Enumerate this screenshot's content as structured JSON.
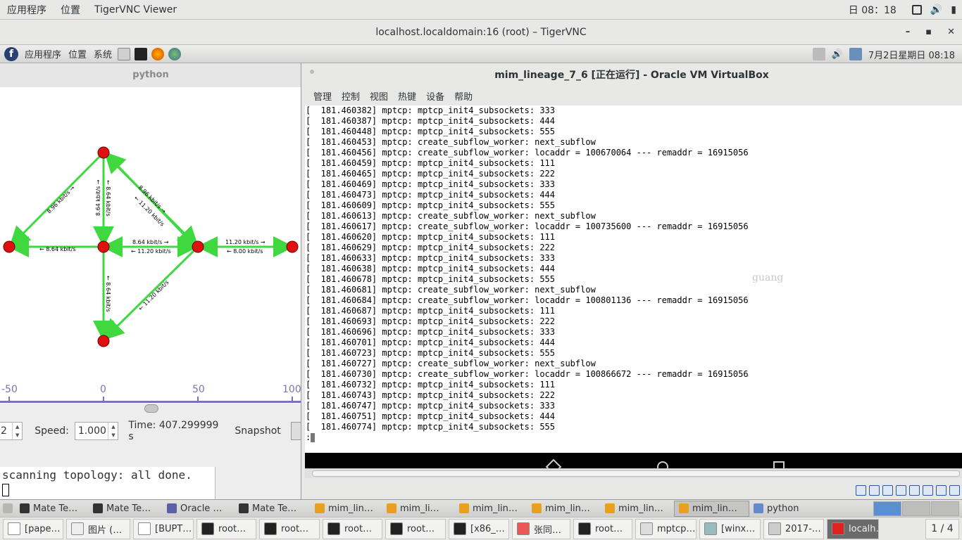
{
  "host_bar": {
    "apps": "应用程序",
    "places": "位置",
    "active_app": "TigerVNC Viewer",
    "clock": "日 08：18"
  },
  "vnc_window": {
    "title": "localhost.localdomain:16 (root) – TigerVNC",
    "minimize": "–",
    "maximize": "▪",
    "close": "✕"
  },
  "mate_panel": {
    "apps": "应用程序",
    "places": "位置",
    "system": "系统",
    "datetime": "7月2日星期日 08:18"
  },
  "python_window": {
    "title": "python",
    "link_labels": [
      "← 8.64 kbit/s",
      "8.96 kbit/s →",
      "8.96 kbit/s →",
      "← 11.20 kbit/s",
      "8.64 kbit/s →",
      "← 11.20 kbit/s",
      "11.20 kbit/s →",
      "← 8.00 kbit/s",
      "8.64 kbit/s →",
      "← 8.64 kbit/s",
      "← 8.64 kbit/s",
      "← 11.20 kbit/s",
      "8.64 kbit/s"
    ],
    "ruler_ticks": [
      "-50",
      "0",
      "50",
      "100"
    ],
    "spin_value": "2",
    "speed_label": "Speed:",
    "speed_value": "1.000",
    "time_text": "Time: 407.299999 s",
    "snapshot_label": "Snapshot",
    "console_text": "scanning topology: all done."
  },
  "vbox_window": {
    "title": "mim_lineage_7_6 [正在运行] - Oracle VM VirtualBox",
    "menu": [
      "管理",
      "控制",
      "视图",
      "热键",
      "设备",
      "帮助"
    ],
    "watermark": "guang",
    "terminal_lines": [
      "[  181.460382] mptcp: mptcp_init4_subsockets: 333",
      "[  181.460387] mptcp: mptcp_init4_subsockets: 444",
      "[  181.460448] mptcp: mptcp_init4_subsockets: 555",
      "[  181.460453] mptcp: create_subflow_worker: next_subflow",
      "[  181.460456] mptcp: create_subflow_worker: locaddr = 100670064 --- remaddr = 16915056",
      "[  181.460459] mptcp: mptcp_init4_subsockets: 111",
      "[  181.460465] mptcp: mptcp_init4_subsockets: 222",
      "[  181.460469] mptcp: mptcp_init4_subsockets: 333",
      "[  181.460473] mptcp: mptcp_init4_subsockets: 444",
      "[  181.460609] mptcp: mptcp_init4_subsockets: 555",
      "[  181.460613] mptcp: create_subflow_worker: next_subflow",
      "[  181.460617] mptcp: create_subflow_worker: locaddr = 100735600 --- remaddr = 16915056",
      "[  181.460620] mptcp: mptcp_init4_subsockets: 111",
      "[  181.460629] mptcp: mptcp_init4_subsockets: 222",
      "[  181.460633] mptcp: mptcp_init4_subsockets: 333",
      "[  181.460638] mptcp: mptcp_init4_subsockets: 444",
      "[  181.460678] mptcp: mptcp_init4_subsockets: 555",
      "[  181.460681] mptcp: create_subflow_worker: next_subflow",
      "[  181.460684] mptcp: create_subflow_worker: locaddr = 100801136 --- remaddr = 16915056",
      "[  181.460687] mptcp: mptcp_init4_subsockets: 111",
      "[  181.460693] mptcp: mptcp_init4_subsockets: 222",
      "[  181.460696] mptcp: mptcp_init4_subsockets: 333",
      "[  181.460701] mptcp: mptcp_init4_subsockets: 444",
      "[  181.460723] mptcp: mptcp_init4_subsockets: 555",
      "[  181.460727] mptcp: create_subflow_worker: next_subflow",
      "[  181.460730] mptcp: create_subflow_worker: locaddr = 100866672 --- remaddr = 16915056",
      "[  181.460732] mptcp: mptcp_init4_subsockets: 111",
      "[  181.460743] mptcp: mptcp_init4_subsockets: 222",
      "[  181.460747] mptcp: mptcp_init4_subsockets: 333",
      "[  181.460751] mptcp: mptcp_init4_subsockets: 444",
      "[  181.460774] mptcp: mptcp_init4_subsockets: 555"
    ],
    "prompt": ":"
  },
  "remote_taskbar": {
    "items": [
      "Mate Te…",
      "Mate Te…",
      "Oracle …",
      "Mate Te…",
      "mim_lin…",
      "mim_li…",
      "mim_lin…",
      "mim_lin…",
      "mim_lin…",
      "mim_lin…",
      "python"
    ]
  },
  "host_taskbar": {
    "items": [
      "[pape…",
      "图片 (…",
      "[BUPT…",
      "root…",
      "root…",
      "root…",
      "root…",
      "[x86_…",
      "张同…",
      "root…",
      "mptcp…",
      "[winx…",
      "2017-…",
      "localh…"
    ],
    "pager": "1 / 4"
  },
  "colors": {
    "link_green": "#3fd93f",
    "node_red": "#e01010",
    "terminal_bg": "#ffffff",
    "vm_bottom_black": "#000000"
  }
}
